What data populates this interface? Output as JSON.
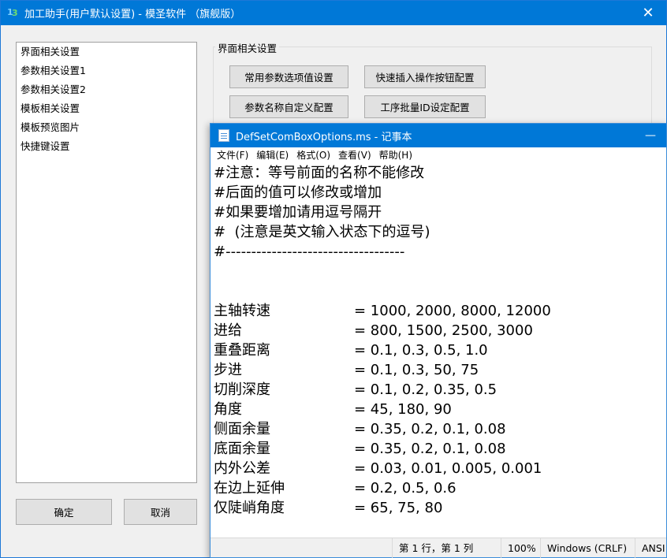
{
  "main_window": {
    "title": "加工助手(用户默认设置) - 模圣软件 （旗舰版）",
    "close_glyph": "✕",
    "nav_items": [
      "界面相关设置",
      "参数相关设置1",
      "参数相关设置2",
      "模板相关设置",
      "模板预览图片",
      "快捷键设置"
    ],
    "group_title": "界面相关设置",
    "buttons": {
      "common_params": "常用参数选项值设置",
      "quick_insert": "快速插入操作按钮配置",
      "param_names": "参数名称自定义配置",
      "batch_id": "工序批量ID设定配置",
      "ok": "确定",
      "cancel": "取消"
    },
    "accent": "#0078d7"
  },
  "notepad": {
    "title": "DefSetComBoxOptions.ms - 记事本",
    "min_glyph": "—",
    "menu": [
      "文件(F)",
      "编辑(E)",
      "格式(O)",
      "查看(V)",
      "帮助(H)"
    ],
    "comments": [
      "#注意：等号前面的名称不能修改",
      "#后面的值可以修改或增加",
      "#如果要增加请用逗号隔开",
      "#  (注意是英文输入状态下的逗号)",
      "#-----------------------------------"
    ],
    "entries": [
      {
        "key": "主轴转速",
        "value": "= 1000, 2000, 8000, 12000"
      },
      {
        "key": "进给",
        "value": "= 800, 1500, 2500, 3000"
      },
      {
        "key": "重叠距离",
        "value": "= 0.1, 0.3, 0.5, 1.0"
      },
      {
        "key": "步进",
        "value": "= 0.1, 0.3, 50, 75"
      },
      {
        "key": "切削深度",
        "value": "= 0.1, 0.2, 0.35, 0.5"
      },
      {
        "key": "角度",
        "value": "= 45, 180, 90"
      },
      {
        "key": "侧面余量",
        "value": "= 0.35, 0.2, 0.1, 0.08"
      },
      {
        "key": "底面余量",
        "value": "= 0.35, 0.2, 0.1, 0.08"
      },
      {
        "key": "内外公差",
        "value": "= 0.03, 0.01, 0.005, 0.001"
      },
      {
        "key": "在边上延伸",
        "value": "= 0.2, 0.5, 0.6"
      },
      {
        "key": "仅陡峭角度",
        "value": "= 65, 75, 80"
      }
    ],
    "status": {
      "position": "第 1 行，第 1 列",
      "zoom": "100%",
      "line_ending": "Windows (CRLF)",
      "encoding": "ANSI"
    }
  }
}
